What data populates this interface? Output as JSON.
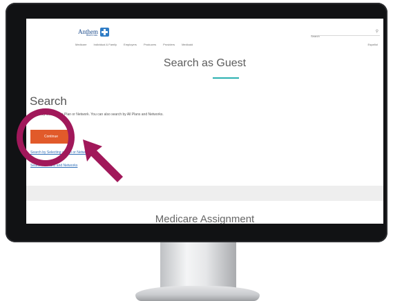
{
  "brand": {
    "logo_text": "Anthem",
    "logo_sub": "BlueCross"
  },
  "header": {
    "search_placeholder": "Search",
    "language_link": "Español",
    "nav": [
      "Medicare",
      "Individual & Family",
      "Employers",
      "Producers",
      "Providers",
      "Medicaid"
    ]
  },
  "page": {
    "title": "Search as Guest",
    "section_heading": "Search",
    "section_description": "Search by Selecting a Plan or Network. You can also search by All Plans and Networks.",
    "continue_label": "Continue",
    "link_plan_network": "Search by Selecting a Plan or Network",
    "link_all_plans": "Search All Plans and Networks",
    "next_section_title": "Medicare Assignment"
  },
  "colors": {
    "accent_orange": "#e15a2a",
    "teal_underline": "#2ab0b0",
    "callout_magenta": "#a1185a",
    "link_blue": "#2f6fb8"
  }
}
